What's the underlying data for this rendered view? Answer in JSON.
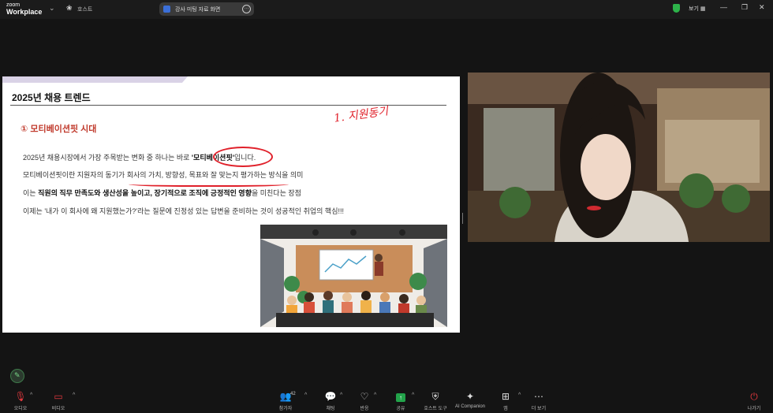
{
  "topbar": {
    "logo_line1": "zoom",
    "logo_line2": "Workplace",
    "host_label": "호스트",
    "meeting_title": "강사 미팅 자료 화면",
    "view_label": "보기",
    "minimize": "—",
    "restore": "❐",
    "close": "✕"
  },
  "slide": {
    "title": "2025년 채용 트렌드",
    "handwritten_note": "1. 지원동기",
    "section_title": "① 모티베이션핏 시대",
    "line1_a": "2025년 채용시장에서 가장 주목받는 변화 중 하나는 바로 ",
    "line1_bold": "'모티베이션핏'",
    "line1_b": "입니다.",
    "line2": "모티베이션핏이란 지원자의 동기가 회사의 가치, 방향성, 목표와 잘 맞는지 평가하는 방식을 의미",
    "line3_a": "이는 ",
    "line3_bold": "직원의 직무 만족도와 생산성을 높이고, 장기적으로 조직에 긍정적인 영향",
    "line3_b": "을 미친다는 장점",
    "line4": "이제는 '내가 이 회사에 왜 지원했는가?'라는 질문에 진정성 있는 답변을 준비하는 것이 성공적인 취업의 핵심!!!"
  },
  "toolbar": {
    "audio": "오디오",
    "video": "비디오",
    "participants": "참가자",
    "participants_count": "42",
    "chat": "채팅",
    "reactions": "반응",
    "share": "공유",
    "host_tools": "호스트 도구",
    "ai_companion": "AI Companion",
    "apps": "앱",
    "more": "더 보기",
    "leave": "나가기"
  },
  "colors": {
    "accent_red": "#e0202a",
    "share_green": "#22a34a",
    "secure_green": "#2db34a"
  }
}
